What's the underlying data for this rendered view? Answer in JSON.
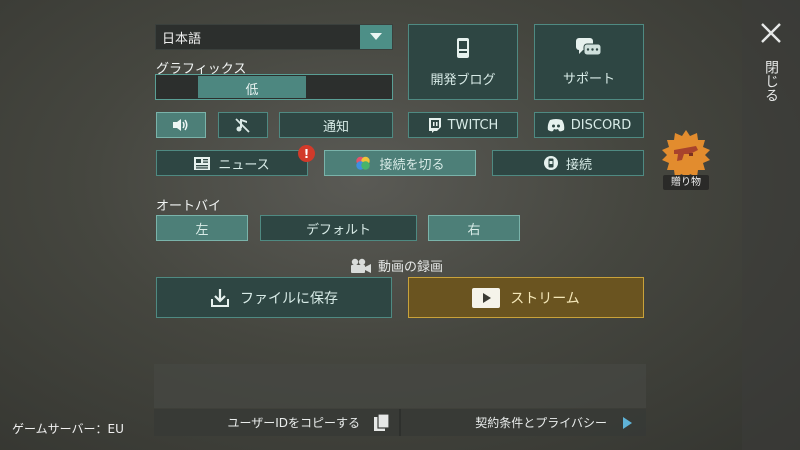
{
  "language": {
    "selected": "日本語"
  },
  "graphics": {
    "title": "グラフィックス",
    "value": "低"
  },
  "tiles": {
    "dev_blog": "開発ブログ",
    "support": "サポート"
  },
  "row2": {
    "notifications": "通知",
    "twitch": "TWITCH",
    "discord": "DISCORD"
  },
  "row3": {
    "news": "ニュース",
    "disconnect": "接続を切る",
    "connect": "接続"
  },
  "autobuy": {
    "title": "オートバイ",
    "left": "左",
    "default": "デフォルト",
    "right": "右"
  },
  "recording": {
    "title": "動画の録画",
    "save_file": "ファイルに保存",
    "stream": "ストリーム"
  },
  "footer": {
    "copy_user_id": "ユーザーIDをコピーする",
    "terms": "契約条件とプライバシー",
    "game_server": "ゲームサーバー：EU"
  },
  "side": {
    "close": "閉じる",
    "gift": "贈り物"
  },
  "colors": {
    "teal_dark": "#2e4643",
    "teal_border": "#4f8a82",
    "teal_light": "#4d7f78",
    "gold": "#c9a23a",
    "alert_red": "#d23a2a"
  }
}
